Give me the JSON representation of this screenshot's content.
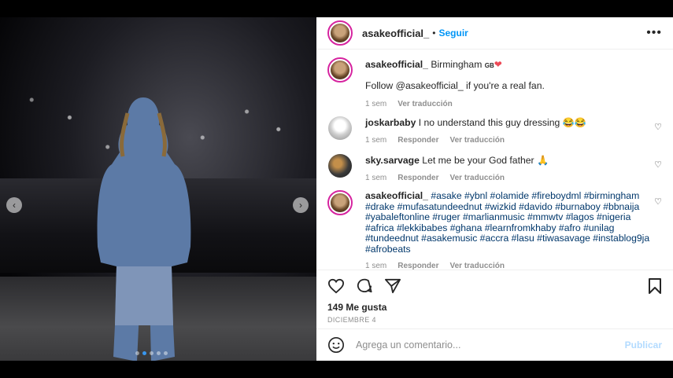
{
  "post": {
    "username": "asakeofficial_",
    "separator": "•",
    "follow_label": "Seguir",
    "more_label": "•••",
    "carousel": {
      "total_slides": 5,
      "active_slide": 2
    }
  },
  "caption": {
    "username": "asakeofficial_",
    "text": "Birmingham",
    "flag": "GB",
    "heart": "❤",
    "line2": "Follow @asakeofficial_ if you're a real fan.",
    "time": "1 sem",
    "translate": "Ver traducción"
  },
  "comments": [
    {
      "username": "joskarbaby",
      "text": "I no understand this guy dressing 😂😂",
      "time": "1 sem",
      "reply": "Responder",
      "translate": "Ver traducción"
    },
    {
      "username": "sky.sarvage",
      "text": "Let me be your God father 🙏",
      "time": "1 sem",
      "reply": "Responder",
      "translate": "Ver traducción"
    },
    {
      "username": "asakeofficial_",
      "text": "#asake #ybnl #olamide #fireboydml #birmingham #drake #mufasatundeednut #wizkid #davido #burnaboy #bbnaija #yabaleftonline #ruger #marlianmusic #mmwtv #lagos #nigeria #africa #lekkibabes #ghana #learnfromkhaby #afro #unilag #tundeednut #asakemusic #accra #lasu #tiwasavage #instablog9ja #afrobeats",
      "time": "1 sem",
      "reply": "Responder",
      "translate": "Ver traducción"
    }
  ],
  "actions": {
    "likes": "149 Me gusta",
    "date": "DICIEMBRE 4"
  },
  "add_comment": {
    "placeholder": "Agrega un comentario...",
    "publish": "Publicar"
  },
  "colors": {
    "link": "#0095f6",
    "hashtag": "#00376b",
    "muted": "#8e8e8e",
    "story_ring": "#d6249f"
  }
}
